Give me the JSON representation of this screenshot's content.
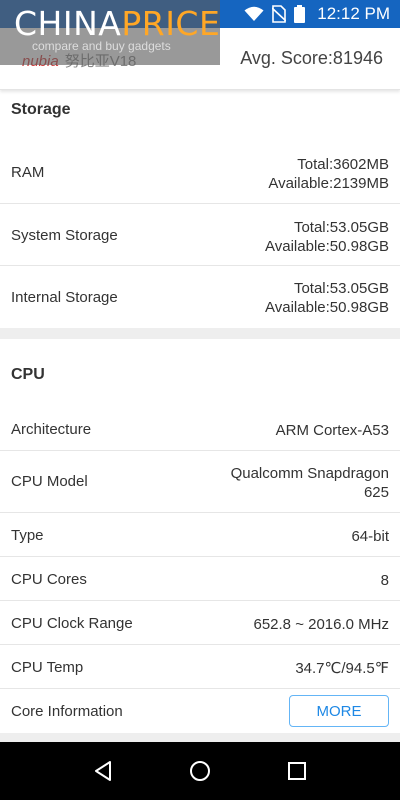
{
  "status_bar": {
    "time": "12:12 PM",
    "icons": [
      "wifi-icon",
      "no-sim-icon",
      "battery-icon"
    ],
    "color": "#1565c0"
  },
  "watermark": {
    "title_part1": "CHINA",
    "title_part2": "PRICE",
    "subtitle": "compare and buy gadgets"
  },
  "header": {
    "device_brand": "nubia",
    "device_model": "努比亚V18",
    "avg_score": "Avg. Score:81946"
  },
  "storage": {
    "title": "Storage",
    "rows": [
      {
        "label": "RAM",
        "total": "Total:3602MB",
        "available": "Available:2139MB"
      },
      {
        "label": "System Storage",
        "total": "Total:53.05GB",
        "available": "Available:50.98GB"
      },
      {
        "label": "Internal Storage",
        "total": "Total:53.05GB",
        "available": "Available:50.98GB"
      }
    ]
  },
  "cpu": {
    "title": "CPU",
    "rows": [
      {
        "label": "Architecture",
        "value": "ARM Cortex-A53"
      },
      {
        "label": "CPU Model",
        "value_line1": "Qualcomm Snapdragon",
        "value_line2": "625"
      },
      {
        "label": "Type",
        "value": "64-bit"
      },
      {
        "label": "CPU Cores",
        "value": "8"
      },
      {
        "label": "CPU Clock Range",
        "value": "652.8 ~ 2016.0 MHz"
      },
      {
        "label": "CPU Temp",
        "value": "34.7℃/94.5℉"
      },
      {
        "label": "Core Information",
        "button": "MORE"
      }
    ]
  },
  "nav": {
    "icons": [
      "back-icon",
      "home-icon",
      "recents-icon"
    ]
  },
  "colors": {
    "accent": "#1e88e5",
    "watermark_accent": "#ffa726"
  }
}
